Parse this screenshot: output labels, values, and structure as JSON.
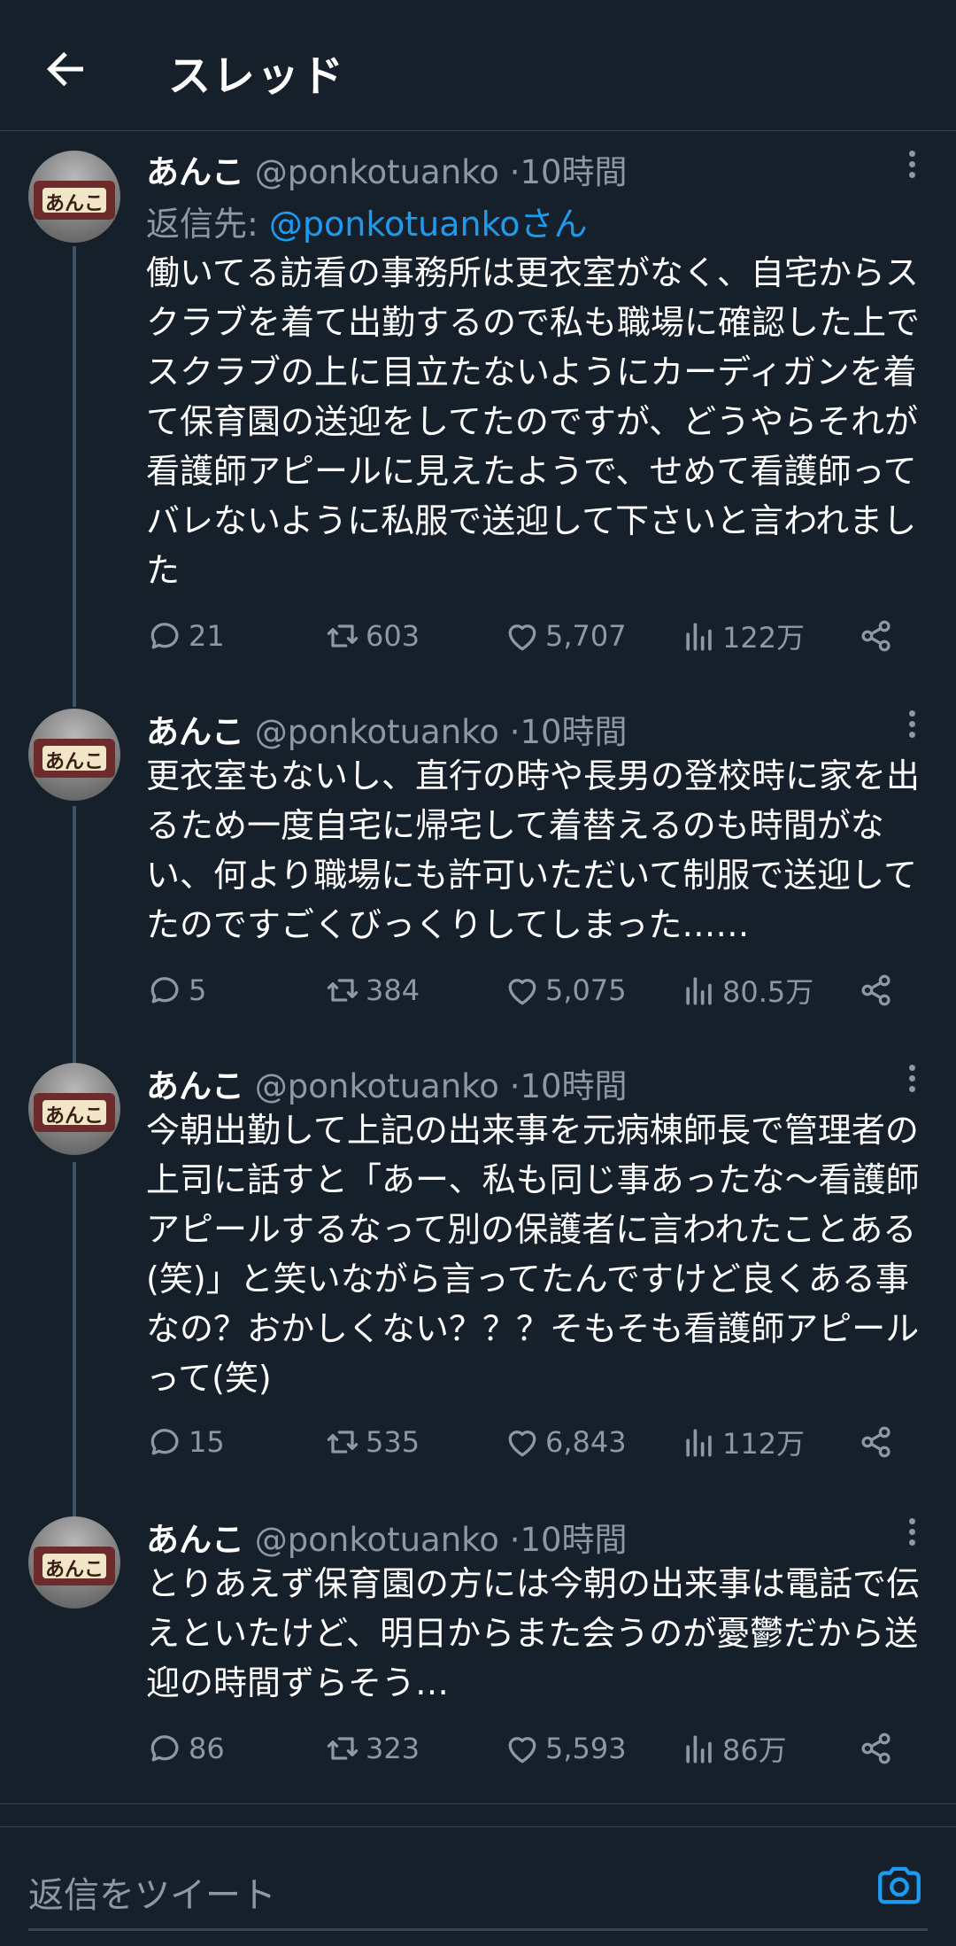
{
  "header": {
    "title": "スレッド",
    "back_icon": "arrow-left-icon"
  },
  "colors": {
    "background": "#15202b",
    "accent": "#1d9bf0",
    "muted": "#8b98a5",
    "thread_line": "#3d5466"
  },
  "tweets": [
    {
      "name": "あんこ",
      "handle": "@ponkotuanko",
      "dot": "·",
      "time": "10時間",
      "avatar_text": "あんこ",
      "reply_prefix": "返信先: ",
      "reply_to": "@ponkotuankoさん",
      "text": "働いてる訪看の事務所は更衣室がなく、自宅からスクラブを着て出勤するので私も職場に確認した上でスクラブの上に目立たないようにカーディガンを着て保育園の送迎をしてたのですが、どうやらそれが看護師アピールに見えたようで、せめて看護師ってバレないように私服で送迎して下さいと言われました",
      "replies": "21",
      "retweets": "603",
      "likes": "5,707",
      "views": "122万"
    },
    {
      "name": "あんこ",
      "handle": "@ponkotuanko",
      "dot": "·",
      "time": "10時間",
      "avatar_text": "あんこ",
      "text": "更衣室もないし、直行の時や長男の登校時に家を出るため一度自宅に帰宅して着替えるのも時間がない、何より職場にも許可いただいて制服で送迎してたのですごくびっくりしてしまった……",
      "replies": "5",
      "retweets": "384",
      "likes": "5,075",
      "views": "80.5万"
    },
    {
      "name": "あんこ",
      "handle": "@ponkotuanko",
      "dot": "·",
      "time": "10時間",
      "avatar_text": "あんこ",
      "text": "今朝出勤して上記の出来事を元病棟師長で管理者の上司に話すと「あー、私も同じ事あったな〜看護師アピールするなって別の保護者に言われたことある(笑)」と笑いながら言ってたんですけど良くある事なの？おかしくない？？？そもそも看護師アピールって(笑)",
      "replies": "15",
      "retweets": "535",
      "likes": "6,843",
      "views": "112万"
    },
    {
      "name": "あんこ",
      "handle": "@ponkotuanko",
      "dot": "·",
      "time": "10時間",
      "avatar_text": "あんこ",
      "text": "とりあえず保育園の方には今朝の出来事は電話で伝えといたけど、明日からまた会うのが憂鬱だから送迎の時間ずらそう…",
      "replies": "86",
      "retweets": "323",
      "likes": "5,593",
      "views": "86万"
    }
  ],
  "composer": {
    "placeholder": "返信をツイート",
    "camera_icon": "camera-icon"
  }
}
